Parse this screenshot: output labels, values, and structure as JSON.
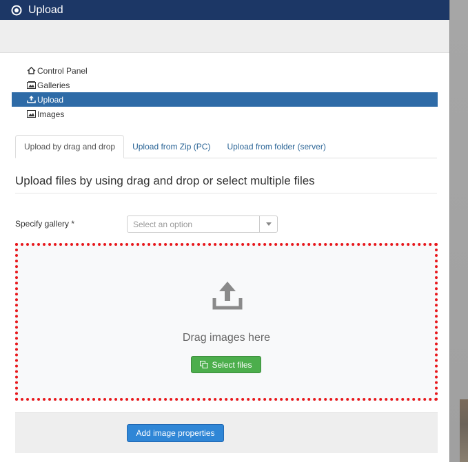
{
  "header": {
    "title": "Upload",
    "logo_icon": "joomla-target-icon"
  },
  "submenu": {
    "items": [
      {
        "label": "Control Panel",
        "icon": "home-icon",
        "active": false
      },
      {
        "label": "Galleries",
        "icon": "images-icon",
        "active": false
      },
      {
        "label": "Upload",
        "icon": "upload-icon",
        "active": true
      },
      {
        "label": "Images",
        "icon": "image-icon",
        "active": false
      }
    ]
  },
  "tabs": [
    {
      "label": "Upload by drag and drop",
      "active": true
    },
    {
      "label": "Upload from Zip (PC)",
      "active": false
    },
    {
      "label": "Upload from folder (server)",
      "active": false
    }
  ],
  "heading": "Upload files by using drag and drop or select multiple files",
  "gallery": {
    "label": "Specify gallery *",
    "placeholder": "Select an option"
  },
  "dropzone": {
    "text": "Drag images here",
    "select_label": "Select files"
  },
  "footer": {
    "add_properties_label": "Add image properties"
  },
  "colors": {
    "header_bg": "#1c3766",
    "active_item_bg": "#2e6ba7",
    "dropzone_border": "#e8171b",
    "select_button": "#4cae4c",
    "primary_button": "#2f86d6"
  }
}
